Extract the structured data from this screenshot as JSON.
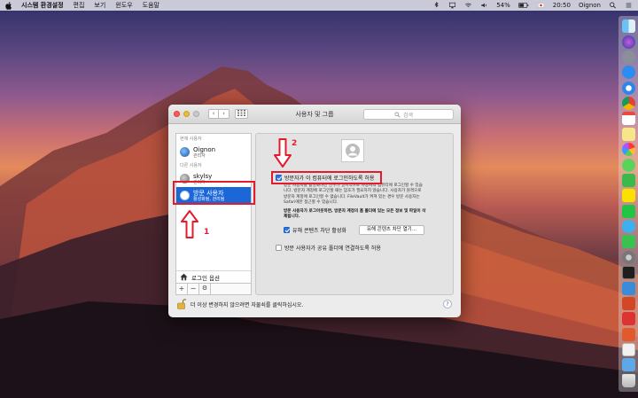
{
  "menubar": {
    "app_name": "시스템 환경설정",
    "items": [
      "편집",
      "보기",
      "윈도우",
      "도움말"
    ],
    "battery": "54%",
    "time": "20:50",
    "user": "Oignon"
  },
  "window": {
    "title": "사용자 및 그룹",
    "search_placeholder": "검색",
    "nav_back": "‹",
    "nav_forward": "›"
  },
  "sidebar": {
    "current_label": "현재 사용자",
    "other_label": "다른 사용자",
    "users": [
      {
        "name": "Oignon",
        "role": "관리자"
      },
      {
        "name": "skylsy",
        "role": "관리자"
      },
      {
        "name": "방문 사용자",
        "role": "활성화됨, 관리됨"
      }
    ],
    "login_options": "로그인 옵션",
    "add": "+",
    "remove": "−",
    "gear": "⚙"
  },
  "panel": {
    "allow_guest_label": "방문자가 이 컴퓨터에 로그인하도록 허용",
    "allow_guest_desc": [
      "방문 사용자를 활성화하면 친구가 일시적으로 사용자의 컴퓨터에 로그인할 수 있습",
      "니다. 방문자 계정에 로그인할 때는 암호가 필요하지 않습니다. 사용자가 원격으로",
      "방문자 계정에 로그인할 수 없습니다. FileVault가 켜져 있는 경우 방문 사용자는",
      "Safari에만 접근할 수 있습니다."
    ],
    "logout_desc": [
      "방문 사용자가 로그아웃하면, 방문자 계정의 홈 폴더에 있는 모든 정보 및 파일이 삭",
      "제됩니다."
    ],
    "parental_label": "유해 콘텐츠 차단 활성화",
    "parental_button": "유해 콘텐츠 차단 열기...",
    "shared_folder_label": "방문 사용자가 공유 폴더에 연결하도록 허용"
  },
  "footer": {
    "lock_text": "더 이상 변경하지 않으려면 자물쇠를 클릭하십시오.",
    "help": "?"
  },
  "annotations": {
    "step1": "1",
    "step2": "2",
    "color": "#e21b2d"
  },
  "colors": {
    "selection": "#1c67d8",
    "checkbox": "#2a73e0"
  }
}
